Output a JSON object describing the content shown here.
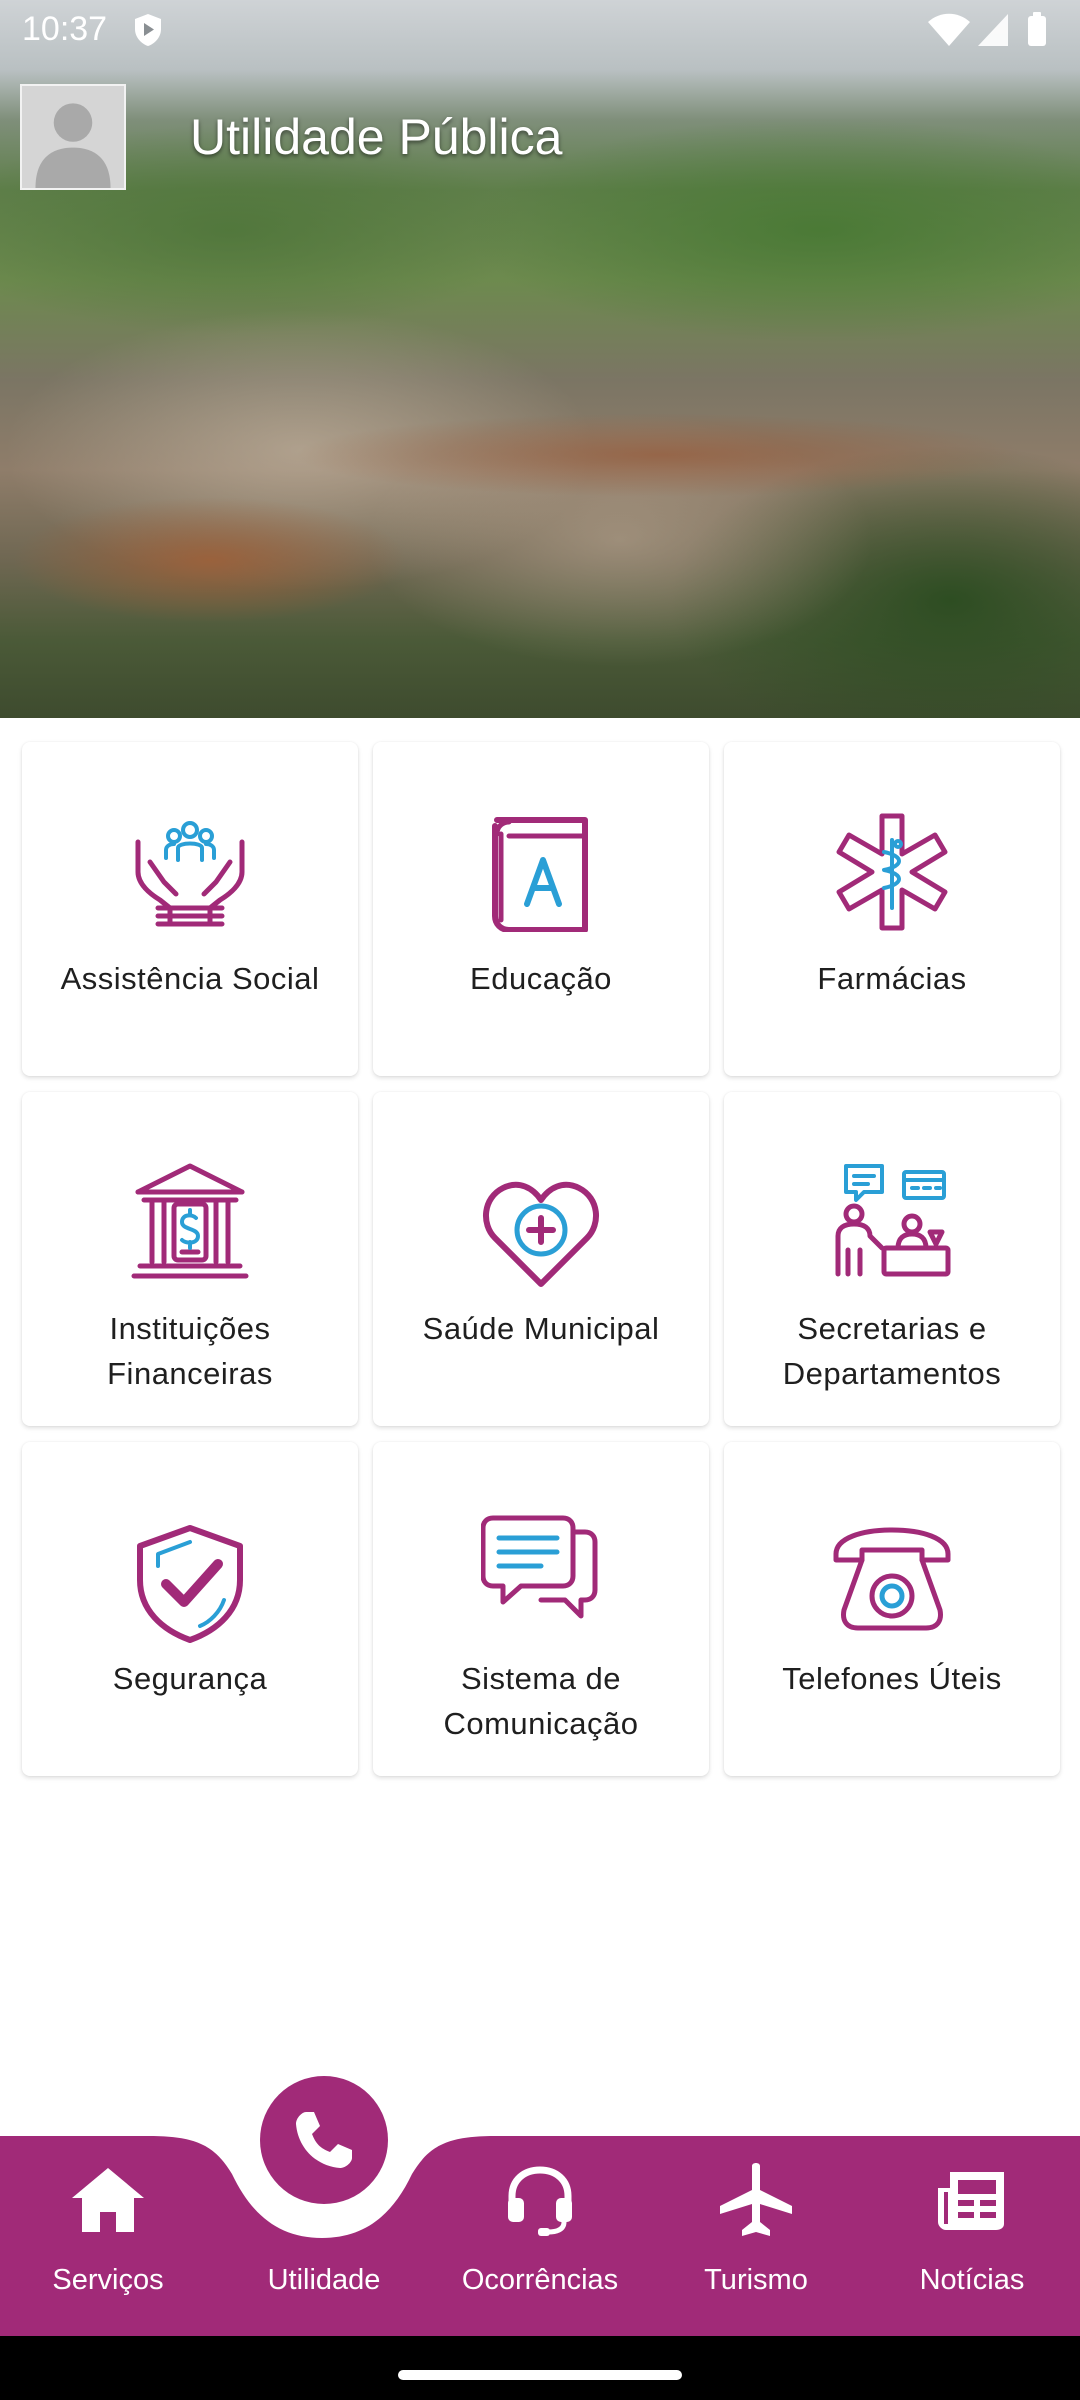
{
  "status_bar": {
    "time": "10:37"
  },
  "header": {
    "title": "Utilidade Pública"
  },
  "colors": {
    "accent": "#a12a78",
    "secondary": "#2a9fd6"
  },
  "cards": [
    {
      "label": "Assistência Social",
      "icon": "hands-people-icon"
    },
    {
      "label": "Educação",
      "icon": "book-icon"
    },
    {
      "label": "Farmácias",
      "icon": "star-of-life-icon"
    },
    {
      "label": "Instituições Financeiras",
      "icon": "bank-icon"
    },
    {
      "label": "Saúde Municipal",
      "icon": "heart-plus-icon"
    },
    {
      "label": "Secretarias e Departamentos",
      "icon": "reception-desk-icon"
    },
    {
      "label": "Segurança",
      "icon": "shield-check-icon"
    },
    {
      "label": "Sistema de Comunicação",
      "icon": "chat-bubbles-icon"
    },
    {
      "label": "Telefones Úteis",
      "icon": "telephone-icon"
    }
  ],
  "bottom_nav": {
    "items": [
      {
        "label": "Serviços",
        "icon": "home-icon"
      },
      {
        "label": "Utilidade",
        "icon": "phone-icon",
        "active": true
      },
      {
        "label": "Ocorrências",
        "icon": "headset-icon"
      },
      {
        "label": "Turismo",
        "icon": "airplane-icon"
      },
      {
        "label": "Notícias",
        "icon": "newspaper-icon"
      }
    ]
  }
}
